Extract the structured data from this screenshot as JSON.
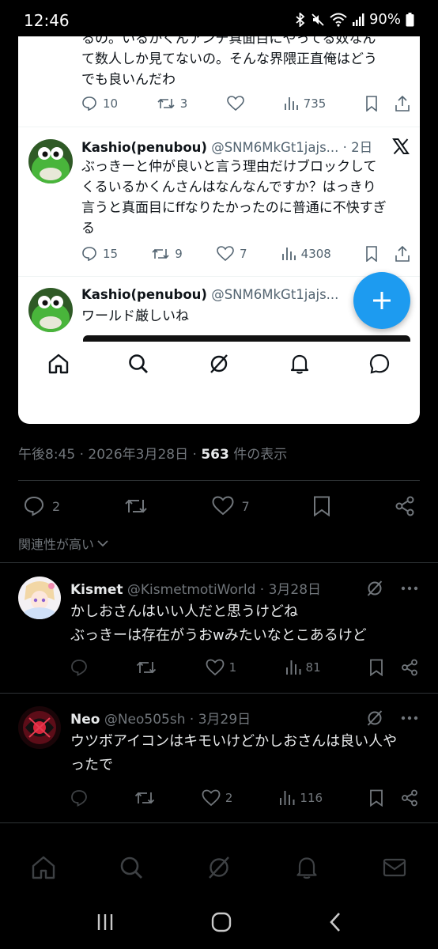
{
  "status_bar": {
    "time": "12:46",
    "battery": "90%"
  },
  "embedded": {
    "snippet_lines": [
      "るの。いるかくんアンチ真面目にやってる奴なん",
      "て数人しか見てないの。そんな界隈正直俺はどう",
      "でも良いんだわ"
    ],
    "snippet_actions": {
      "replies": "10",
      "reposts": "3",
      "views": "735"
    },
    "tweet1": {
      "name": "Kashio(penubou)",
      "handle": "@SNM6MkGt1jajs...",
      "time": "· 2日",
      "lines": [
        "ぶっきーと仲が良いと言う理由だけブロックして",
        "くるいるかくんさんはなんなんですか？はっきり",
        "言うと真面目にffなりたかったのに普通に不快すぎ",
        "る"
      ],
      "replies": "15",
      "reposts": "9",
      "likes": "7",
      "views": "4308"
    },
    "tweet2": {
      "name": "Kashio(penubou)",
      "handle": "@SNM6MkGt1jajs...",
      "text": "ワールド厳しいね"
    }
  },
  "post_meta": {
    "time": "午後8:45 · 2026年3月28日 · ",
    "views_count": "563",
    "views_label": " 件の表示"
  },
  "post_actions": {
    "replies": "2",
    "likes": "7"
  },
  "sort_label": "関連性が高い",
  "replies": [
    {
      "name": "Kismet",
      "handle": "@KismetmotiWorld · 3月28日",
      "lines": [
        "かしおさんはいい人だと思うけどね",
        "ぶっきーは存在がうおwみたいなとこあるけど"
      ],
      "likes": "1",
      "views": "81"
    },
    {
      "name": "Neo",
      "handle": "@Neo505sh · 3月29日",
      "lines": [
        "ウツボアイコンはキモいけどかしおさんは良い人や",
        "ったで"
      ],
      "likes": "2",
      "views": "116"
    }
  ],
  "colors": {
    "accent": "#1d9bf0",
    "muted": "#71767b",
    "divider": "#2f3336"
  }
}
